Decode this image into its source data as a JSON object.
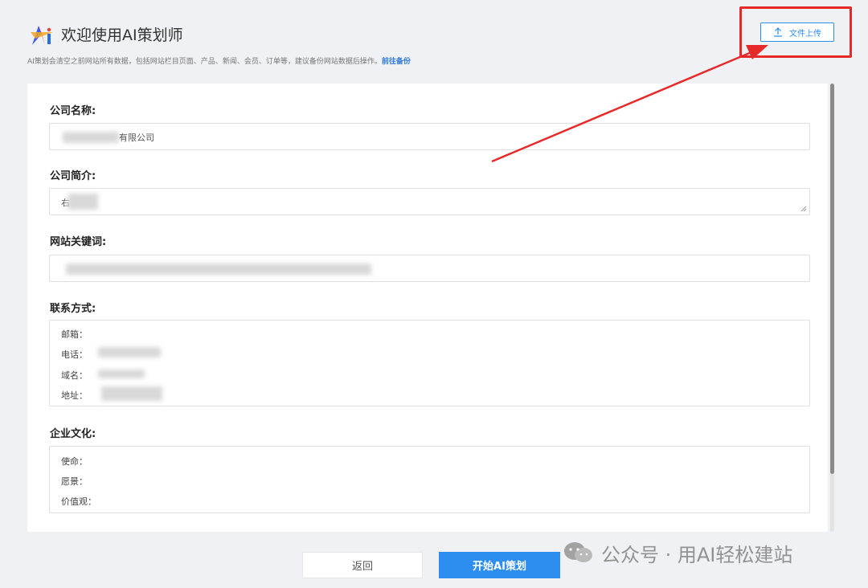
{
  "header": {
    "title": "欢迎使用AI策划师",
    "notice": "AI策划会清空之前网站所有数据，包括网站栏目页面、产品、新闻、会员、订单等，建议备份网站数据后操作。",
    "notice_link": "前往备份",
    "upload_label": "文件上传",
    "upload_icon": "upload-icon"
  },
  "form": {
    "company_name": {
      "label": "公司名称:",
      "value_visible": "有限公司"
    },
    "company_intro": {
      "label": "公司简介:",
      "value_visible": "右"
    },
    "keywords": {
      "label": "网站关键词:"
    },
    "contact": {
      "label": "联系方式:",
      "lines": [
        "邮箱：",
        "电话：",
        "域名：",
        "地址："
      ]
    },
    "culture": {
      "label": "企业文化:",
      "lines": [
        "使命：",
        "愿景：",
        "价值观："
      ]
    }
  },
  "actions": {
    "back_label": "返回",
    "start_label": "开始AI策划"
  },
  "watermark": {
    "text": "公众号 · 用AI轻松建站"
  },
  "colors": {
    "accent": "#2e8ef0",
    "highlight": "#e62a2a",
    "background": "#f0f1f4"
  }
}
